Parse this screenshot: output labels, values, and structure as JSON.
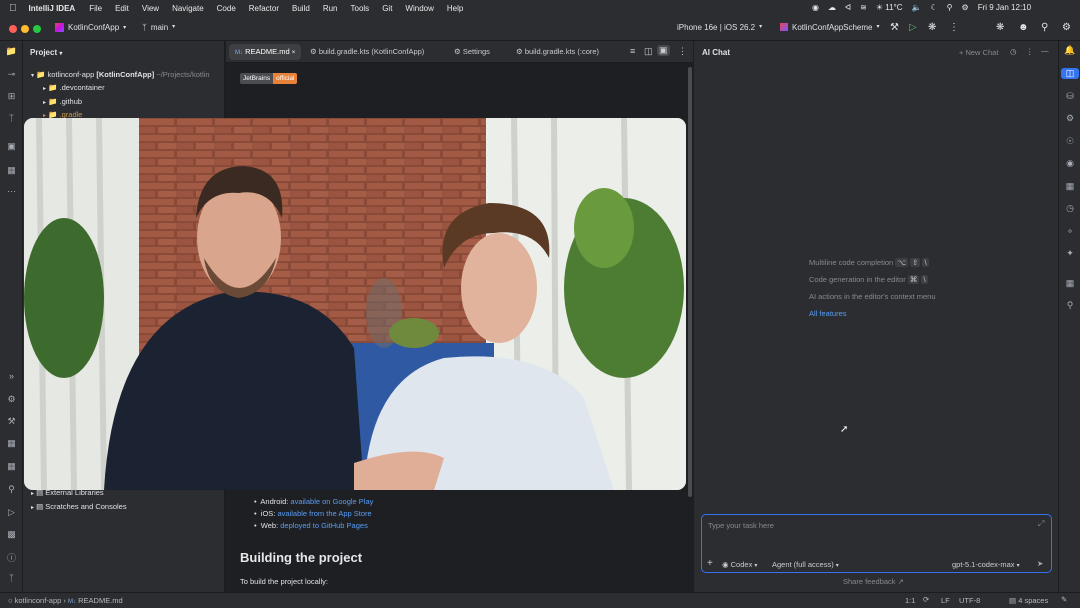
{
  "menubar": {
    "app": "IntelliJ IDEA",
    "items": [
      "File",
      "Edit",
      "View",
      "Navigate",
      "Code",
      "Refactor",
      "Build",
      "Run",
      "Tools",
      "Git",
      "Window",
      "Help"
    ],
    "weather": "11°C",
    "clock": "Fri 9 Jan 12:10"
  },
  "titlebar": {
    "project": "KotlinConfApp",
    "branch": "main",
    "device": "iPhone 16e | iOS 26.2",
    "scheme": "KotlinConfAppScheme"
  },
  "project": {
    "header": "Project",
    "root_name": "kotlinconf-app",
    "root_module": "[KotlinConfApp]",
    "root_path": "~/Projects/kotlin",
    "items": [
      ".devcontainer",
      ".github",
      ".gradle"
    ],
    "bottom_items": [
      "External Libraries",
      "Scratches and Consoles"
    ]
  },
  "editor": {
    "tabs": [
      "README.md",
      "build.gradle.kts (KotlinConfApp)",
      "Settings",
      "build.gradle.kts (:core)"
    ],
    "badge_left": "JetBrains",
    "badge_right": "official",
    "bullets": [
      {
        "label": "Android:",
        "link": "available on Google Play"
      },
      {
        "label": "iOS:",
        "link": "available from the App Store"
      },
      {
        "label": "Web:",
        "link": "deployed to GitHub Pages"
      }
    ],
    "heading": "Building the project",
    "paragraph": "To build the project locally:"
  },
  "ai": {
    "title": "AI Chat",
    "new_chat": "New Chat",
    "hints": [
      {
        "text": "Multiline code completion",
        "keys": [
          "⌥",
          "⇧",
          "\\"
        ]
      },
      {
        "text": "Code generation in the editor",
        "keys": [
          "⌘",
          "\\"
        ]
      },
      {
        "text": "AI actions in the editor's context menu",
        "keys": []
      }
    ],
    "all_features": "All features",
    "placeholder": "Type your task here",
    "agent_name": "Codex",
    "mode": "Agent (full access)",
    "model": "gpt-5.1-codex-max",
    "feedback": "Share feedback ↗"
  },
  "status": {
    "breadcrumb_root": "kotlinconf-app",
    "breadcrumb_file": "README.md",
    "position": "1:1",
    "line_sep": "LF",
    "encoding": "UTF-8",
    "indent": "4 spaces"
  },
  "colors": {
    "accent": "#3574f0",
    "badge_orange": "#e8813a"
  }
}
